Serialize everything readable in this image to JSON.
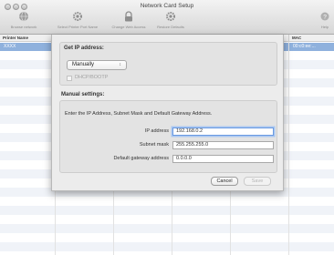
{
  "window": {
    "title": "Network Card Setup"
  },
  "toolbar": {
    "items": [
      {
        "label": "Browse network",
        "icon": "globe-icon"
      },
      {
        "label": "Select Printer Port Name",
        "icon": "gear-icon"
      },
      {
        "label": "Change Web Access",
        "icon": "lock-icon"
      },
      {
        "label": "Restore Defaults",
        "icon": "gear-icon"
      },
      {
        "label": "Help",
        "icon": "help-icon"
      }
    ]
  },
  "table": {
    "columns": [
      "Printer Name",
      "MAC"
    ],
    "selected_row": {
      "printer_name": "XXXX",
      "mac": "00:c0:ee:..."
    }
  },
  "dialog": {
    "get_ip": {
      "heading": "Get IP address:",
      "method": "Manually",
      "dhcp_label": "DHCP/BOOTP"
    },
    "manual": {
      "heading": "Manual settings:",
      "instruction": "Enter the IP Address, Subnet Mask and Default Gateway Address.",
      "ip_label": "IP address",
      "ip_value": "192.168.0.2",
      "subnet_label": "Subnet mask",
      "subnet_value": "255.255.255.0",
      "gateway_label": "Default gateway address",
      "gateway_value": "0.0.0.0"
    },
    "buttons": {
      "cancel": "Cancel",
      "save": "Save"
    }
  },
  "colors": {
    "selection": "#8fb1dd",
    "focus_ring": "#6a9ae0"
  }
}
